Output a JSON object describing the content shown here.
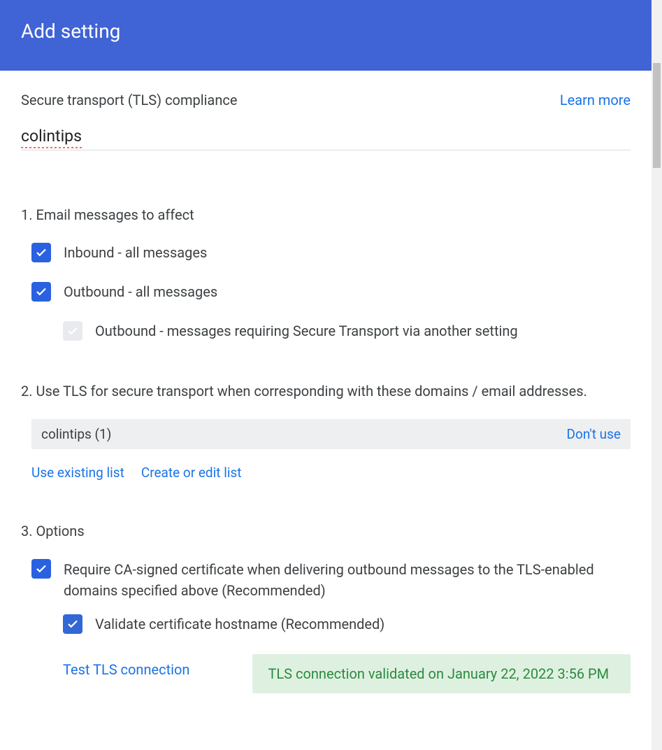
{
  "header": {
    "title": "Add setting"
  },
  "top": {
    "subtitle": "Secure transport (TLS) compliance",
    "learn_more": "Learn more"
  },
  "name_input": {
    "value": "colintips"
  },
  "section1": {
    "heading": "1. Email messages to affect",
    "inbound_label": "Inbound - all messages",
    "outbound_label": "Outbound - all messages",
    "outbound_secure_label": "Outbound - messages requiring Secure Transport via another setting"
  },
  "section2": {
    "heading": "2. Use TLS for secure transport when corresponding with these domains / email addresses.",
    "list_name": "colintips (1)",
    "dont_use": "Don't use",
    "use_existing": "Use existing list",
    "create_edit": "Create or edit list"
  },
  "section3": {
    "heading": "3. Options",
    "require_ca_label": "Require CA-signed certificate when delivering outbound messages to the TLS-enabled domains specified above (Recommended)",
    "validate_hostname_label": "Validate certificate hostname (Recommended)",
    "test_link": "Test TLS connection",
    "status_text": "TLS connection validated on January 22, 2022 3:56 PM"
  }
}
